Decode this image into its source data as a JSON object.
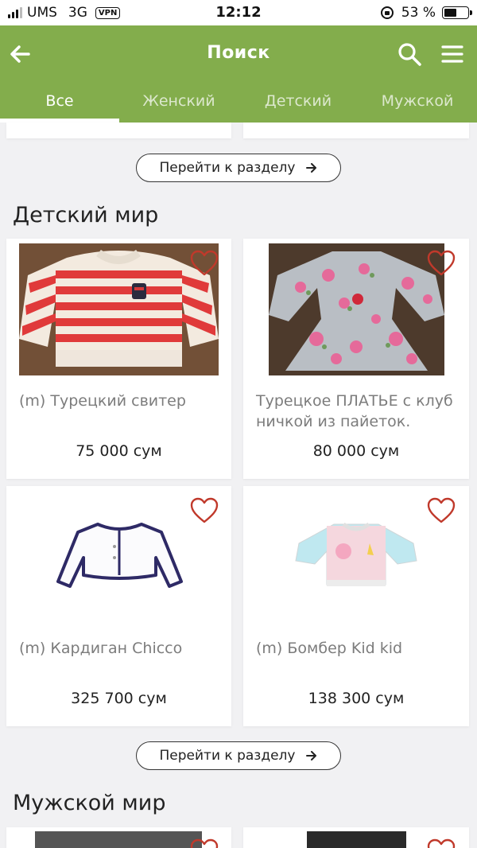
{
  "status_bar": {
    "carrier": "UMS",
    "network": "3G",
    "vpn": "VPN",
    "time": "12:12",
    "battery": "53 %",
    "battery_level": 0.53
  },
  "header": {
    "title": "Поиск"
  },
  "tabs": [
    "Все",
    "Женский",
    "Детский",
    "Мужской"
  ],
  "active_tab": 0,
  "goto_label": "Перейти к разделу",
  "sections": [
    {
      "title": "Детский мир",
      "products": [
        {
          "name": "(m) Турецкий свитер",
          "price": "75 000 сум"
        },
        {
          "name": "Турецкое ПЛАТЬЕ с клубничкой из пайеток.",
          "price": "80 000 сум"
        },
        {
          "name": "(m) Кардиган Chicco",
          "price": "325 700 сум"
        },
        {
          "name": "(m) Бомбер Kid kid",
          "price": "138 300 сум"
        }
      ]
    },
    {
      "title": "Мужской мир"
    }
  ],
  "colors": {
    "brand_green": "#83ad4c",
    "heart": "#c0392b",
    "background": "#f1f1f3"
  }
}
